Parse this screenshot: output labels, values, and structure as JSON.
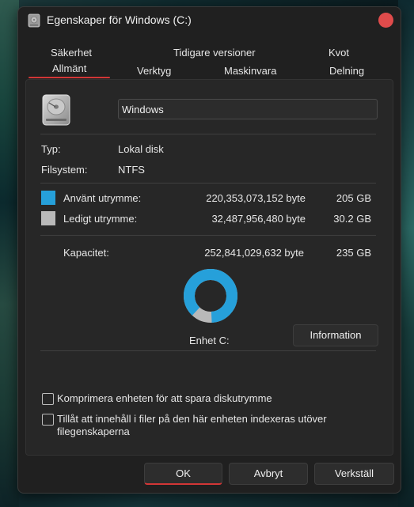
{
  "window": {
    "title": "Egenskaper för Windows (C:)"
  },
  "tabs": {
    "row1": [
      "Säkerhet",
      "Tidigare versioner",
      "Kvot"
    ],
    "row2": [
      "Allmänt",
      "Verktyg",
      "Maskinvara",
      "Delning"
    ],
    "active": "Allmänt"
  },
  "general": {
    "drive_name": "Windows",
    "type_label": "Typ:",
    "type_value": "Lokal disk",
    "fs_label": "Filsystem:",
    "fs_value": "NTFS",
    "used_label": "Använt utrymme:",
    "used_bytes": "220,353,073,152 byte",
    "used_size": "205 GB",
    "used_color": "#26a0da",
    "free_label": "Ledigt utrymme:",
    "free_bytes": "32,487,956,480 byte",
    "free_size": "30.2 GB",
    "free_color": "#b9b9b9",
    "capacity_label": "Kapacitet:",
    "capacity_bytes": "252,841,029,632 byte",
    "capacity_size": "235 GB",
    "drive_label": "Enhet C:",
    "info_button": "Information",
    "compress_label": "Komprimera enheten för att spara diskutrymme",
    "index_label": "Tillåt att innehåll i filer på den här enheten indexeras utöver",
    "index_label_2": "filegenskaperna",
    "usage_fraction": 0.8715
  },
  "buttons": {
    "ok": "OK",
    "cancel": "Avbryt",
    "apply": "Verkställ"
  },
  "colors": {
    "accent": "#d23636",
    "close": "#e04b4b"
  }
}
